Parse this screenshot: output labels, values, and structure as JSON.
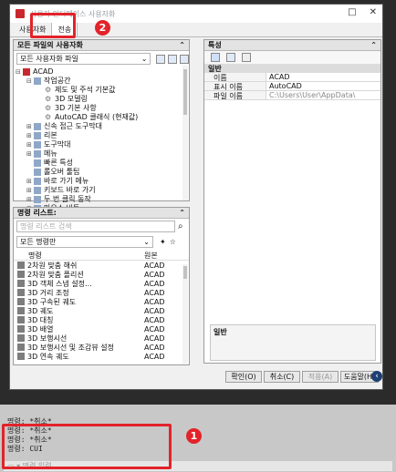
{
  "dialog": {
    "title": "사용자 인터페이스 사용자화",
    "tabs": [
      "사용자화",
      "전송"
    ],
    "customize_panel": {
      "header": "모든 파일의 사용자화",
      "file_combo": "모든 사용자화 파일",
      "tree": [
        {
          "label": "ACAD",
          "level": 0,
          "twisty": "⊟"
        },
        {
          "label": "작업공간",
          "level": 1,
          "twisty": "⊟"
        },
        {
          "label": "제도 및 주석 기본값",
          "level": 2,
          "twisty": ""
        },
        {
          "label": "3D 모델링",
          "level": 2,
          "twisty": ""
        },
        {
          "label": "3D 기본 사항",
          "level": 2,
          "twisty": ""
        },
        {
          "label": "AutoCAD 클래식 (현재값)",
          "level": 2,
          "twisty": ""
        },
        {
          "label": "신속 접근 도구막대",
          "level": 1,
          "twisty": "⊞"
        },
        {
          "label": "리본",
          "level": 1,
          "twisty": "⊞"
        },
        {
          "label": "도구막대",
          "level": 1,
          "twisty": "⊞"
        },
        {
          "label": "메뉴",
          "level": 1,
          "twisty": "⊞"
        },
        {
          "label": "빠른 특성",
          "level": 1,
          "twisty": ""
        },
        {
          "label": "롤오버 툴팁",
          "level": 1,
          "twisty": ""
        },
        {
          "label": "바로 가기 메뉴",
          "level": 1,
          "twisty": "⊞"
        },
        {
          "label": "키보드 바로 가기",
          "level": 1,
          "twisty": "⊞"
        },
        {
          "label": "두 번 클릭 동작",
          "level": 1,
          "twisty": "⊞"
        },
        {
          "label": "마우스 버튼",
          "level": 1,
          "twisty": "⊞"
        },
        {
          "label": "LISP 파일",
          "level": 1,
          "twisty": ""
        }
      ]
    },
    "command_panel": {
      "header": "명령 리스트:",
      "search_placeholder": "명령 리스트 검색",
      "filter_combo": "모든 명령만",
      "columns": [
        "명령",
        "원본"
      ],
      "rows": [
        {
          "name": "2차원 맞춤 해쉬",
          "source": "ACAD"
        },
        {
          "name": "2차원 맞춤 플리션",
          "source": "ACAD"
        },
        {
          "name": "3D 객체 스냅 설정...",
          "source": "ACAD"
        },
        {
          "name": "3D 거리 조정",
          "source": "ACAD"
        },
        {
          "name": "3D 구속된 궤도",
          "source": "ACAD"
        },
        {
          "name": "3D 궤도",
          "source": "ACAD"
        },
        {
          "name": "3D 대칭",
          "source": "ACAD"
        },
        {
          "name": "3D 배열",
          "source": "ACAD"
        },
        {
          "name": "3D 보행시선",
          "source": "ACAD"
        },
        {
          "name": "3D 보행시선 및 조감뷰 설정",
          "source": "ACAD"
        },
        {
          "name": "3D 연속 궤도",
          "source": "ACAD"
        }
      ]
    },
    "properties_panel": {
      "header": "특성",
      "group": "일반",
      "rows": [
        {
          "key": "이름",
          "value": "ACAD"
        },
        {
          "key": "표시 이름",
          "value": "AutoCAD"
        },
        {
          "key": "파일 이름",
          "value": "C:\\Users\\User\\AppData\\"
        }
      ],
      "description_title": "일반"
    },
    "buttons": {
      "ok": "확인(O)",
      "cancel": "취소(C)",
      "apply": "적용(A)",
      "help": "도움말(H)"
    }
  },
  "command_line": {
    "lines": [
      "명령: *취소*",
      "명령: *취소*",
      "명령: *취소*",
      "명령: CUI"
    ],
    "input_placeholder": "명령 입력"
  },
  "markers": {
    "one": "1",
    "two": "2"
  },
  "colors": {
    "marker": "#e2232a",
    "acad_icon": "#c8282d"
  }
}
